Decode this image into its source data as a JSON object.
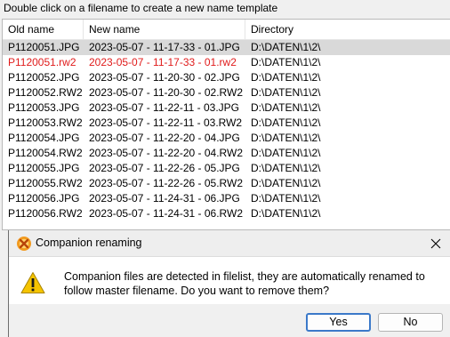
{
  "hint_text": "Double click on a filename to create a new name template",
  "table": {
    "columns": [
      "Old name",
      "New name",
      "Directory"
    ],
    "rows": [
      {
        "old": "P1120051.JPG",
        "new": "2023-05-07 - 11-17-33 - 01.JPG",
        "dir": "D:\\DATEN\\1\\2\\",
        "selected": true,
        "highlight": false
      },
      {
        "old": "P1120051.rw2",
        "new": "2023-05-07 - 11-17-33 - 01.rw2",
        "dir": "D:\\DATEN\\1\\2\\",
        "selected": false,
        "highlight": true
      },
      {
        "old": "P1120052.JPG",
        "new": "2023-05-07 - 11-20-30 - 02.JPG",
        "dir": "D:\\DATEN\\1\\2\\",
        "selected": false,
        "highlight": false
      },
      {
        "old": "P1120052.RW2",
        "new": "2023-05-07 - 11-20-30 - 02.RW2",
        "dir": "D:\\DATEN\\1\\2\\",
        "selected": false,
        "highlight": false
      },
      {
        "old": "P1120053.JPG",
        "new": "2023-05-07 - 11-22-11 - 03.JPG",
        "dir": "D:\\DATEN\\1\\2\\",
        "selected": false,
        "highlight": false
      },
      {
        "old": "P1120053.RW2",
        "new": "2023-05-07 - 11-22-11 - 03.RW2",
        "dir": "D:\\DATEN\\1\\2\\",
        "selected": false,
        "highlight": false
      },
      {
        "old": "P1120054.JPG",
        "new": "2023-05-07 - 11-22-20 - 04.JPG",
        "dir": "D:\\DATEN\\1\\2\\",
        "selected": false,
        "highlight": false
      },
      {
        "old": "P1120054.RW2",
        "new": "2023-05-07 - 11-22-20 - 04.RW2",
        "dir": "D:\\DATEN\\1\\2\\",
        "selected": false,
        "highlight": false
      },
      {
        "old": "P1120055.JPG",
        "new": "2023-05-07 - 11-22-26 - 05.JPG",
        "dir": "D:\\DATEN\\1\\2\\",
        "selected": false,
        "highlight": false
      },
      {
        "old": "P1120055.RW2",
        "new": "2023-05-07 - 11-22-26 - 05.RW2",
        "dir": "D:\\DATEN\\1\\2\\",
        "selected": false,
        "highlight": false
      },
      {
        "old": "P1120056.JPG",
        "new": "2023-05-07 - 11-24-31 - 06.JPG",
        "dir": "D:\\DATEN\\1\\2\\",
        "selected": false,
        "highlight": false
      },
      {
        "old": "P1120056.RW2",
        "new": "2023-05-07 - 11-24-31 - 06.RW2",
        "dir": "D:\\DATEN\\1\\2\\",
        "selected": false,
        "highlight": false
      }
    ]
  },
  "dialog": {
    "title": "Companion renaming",
    "app_icon": "xnview-icon",
    "message_icon": "warning-icon",
    "message": "Companion files are detected in filelist, they are automatically renamed to follow master filename. Do you want to remove them?",
    "yes_label": "Yes",
    "no_label": "No"
  },
  "colors": {
    "highlight_text": "#e01b1b",
    "selected_row": "#d9d9d9",
    "default_button_border": "#3b79c9",
    "warning_fill": "#f5c400"
  }
}
